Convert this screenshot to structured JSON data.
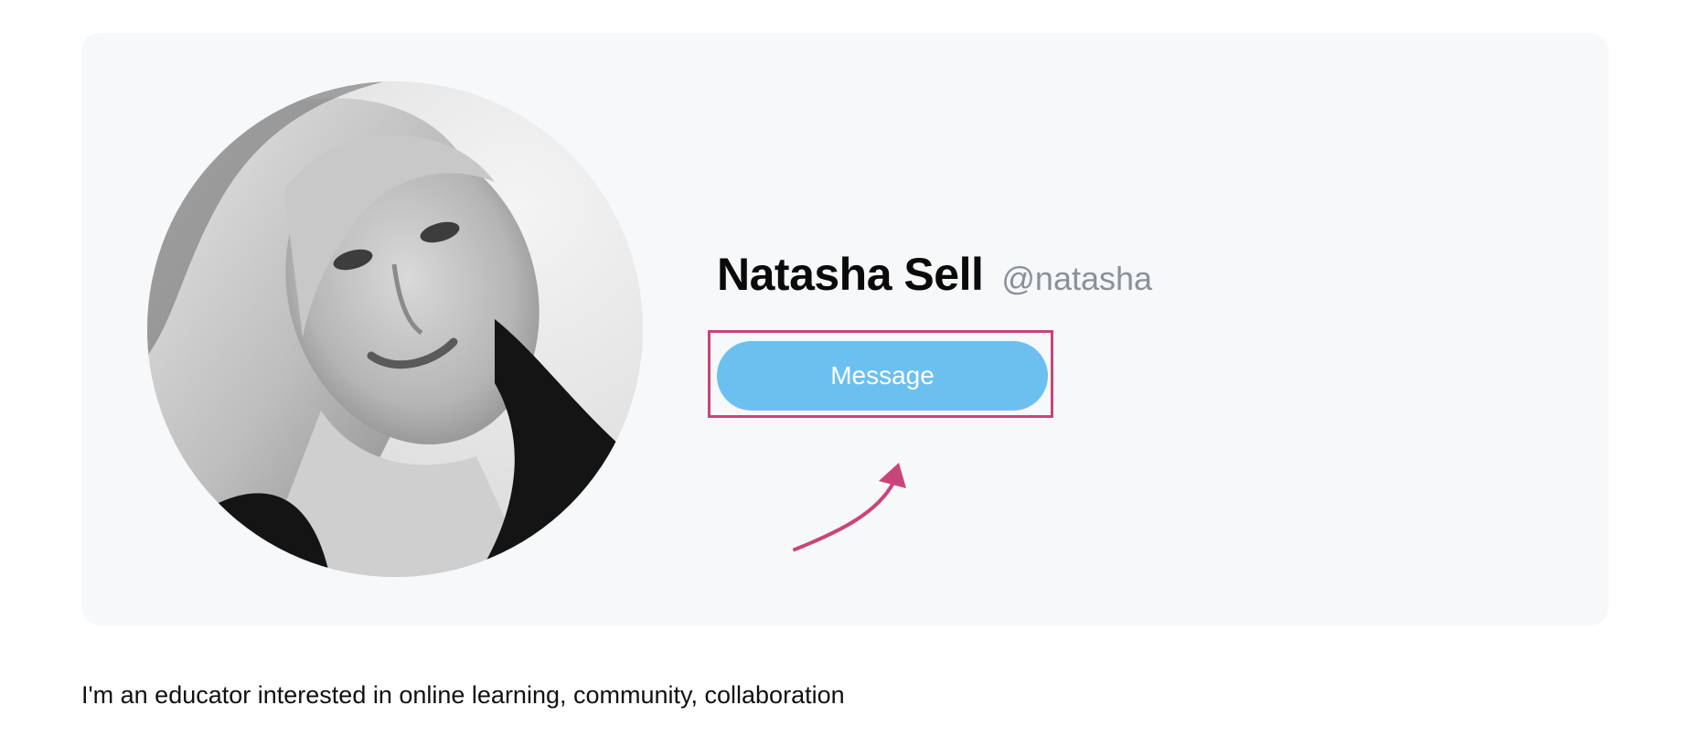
{
  "profile": {
    "display_name": "Natasha Sell",
    "handle": "@natasha",
    "avatar_icon": "profile-photo",
    "message_button_label": "Message",
    "bio": "I'm an educator interested in online learning, community, collaboration"
  },
  "annotation": {
    "highlight_color": "#c8457a",
    "arrow_icon": "curved-arrow-icon"
  },
  "colors": {
    "card_background": "#f7f8f9",
    "button_background": "#6cc0f0",
    "handle_text": "#8a9199"
  }
}
